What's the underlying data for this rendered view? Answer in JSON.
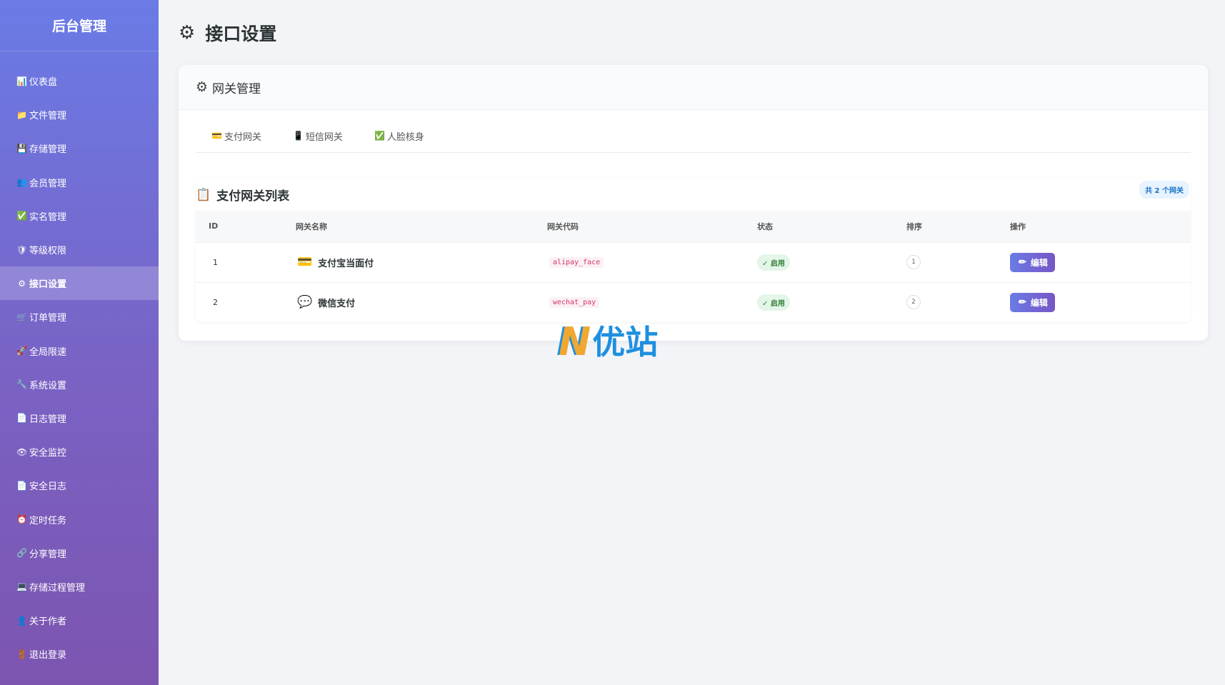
{
  "sidebar": {
    "brand": "后台管理",
    "items": [
      {
        "icon": "📊",
        "label": "仪表盘"
      },
      {
        "icon": "📁",
        "label": "文件管理"
      },
      {
        "icon": "💾",
        "label": "存储管理"
      },
      {
        "icon": "👥",
        "label": "会员管理"
      },
      {
        "icon": "✅",
        "label": "实名管理"
      },
      {
        "icon": "🛡",
        "label": "等级权限"
      },
      {
        "icon": "⚙",
        "label": "接口设置",
        "active": true
      },
      {
        "icon": "🛒",
        "label": "订单管理"
      },
      {
        "icon": "🚀",
        "label": "全局限速"
      },
      {
        "icon": "🔧",
        "label": "系统设置"
      },
      {
        "icon": "📄",
        "label": "日志管理"
      },
      {
        "icon": "👁",
        "label": "安全监控"
      },
      {
        "icon": "📄",
        "label": "安全日志"
      },
      {
        "icon": "⏰",
        "label": "定时任务"
      },
      {
        "icon": "🔗",
        "label": "分享管理"
      },
      {
        "icon": "💻",
        "label": "存储过程管理"
      },
      {
        "icon": "👤",
        "label": "关于作者"
      },
      {
        "icon": "🚪",
        "label": "退出登录"
      }
    ]
  },
  "page": {
    "title": "接口设置",
    "title_icon": "⚙"
  },
  "card": {
    "header_icon": "⚙",
    "header_title": "网关管理",
    "tabs": [
      {
        "icon": "💳",
        "label": "支付网关"
      },
      {
        "icon": "📱",
        "label": "短信网关"
      },
      {
        "icon": "✅",
        "label": "人脸核身"
      }
    ]
  },
  "gateway_list": {
    "icon": "📋",
    "title": "支付网关列表",
    "count_badge": "共 2 个网关",
    "columns": [
      "ID",
      "网关名称",
      "网关代码",
      "状态",
      "排序",
      "操作"
    ],
    "rows": [
      {
        "id": "1",
        "icon": "💳",
        "name": "支付宝当面付",
        "code": "alipay_face",
        "status": "✓ 启用",
        "sort": "1",
        "action": "编辑",
        "action_icon": "✏"
      },
      {
        "id": "2",
        "icon": "💬",
        "name": "微信支付",
        "code": "wechat_pay",
        "status": "✓ 启用",
        "sort": "2",
        "action": "编辑",
        "action_icon": "✏"
      }
    ]
  },
  "watermark": {
    "mark": "N",
    "text": "优站"
  },
  "colors": {
    "sidebar_top": "#6a7be6",
    "sidebar_bottom": "#7c55b0",
    "accent": "#7656c4",
    "status_green": "#2e7d32",
    "code_pink": "#d6336c"
  }
}
